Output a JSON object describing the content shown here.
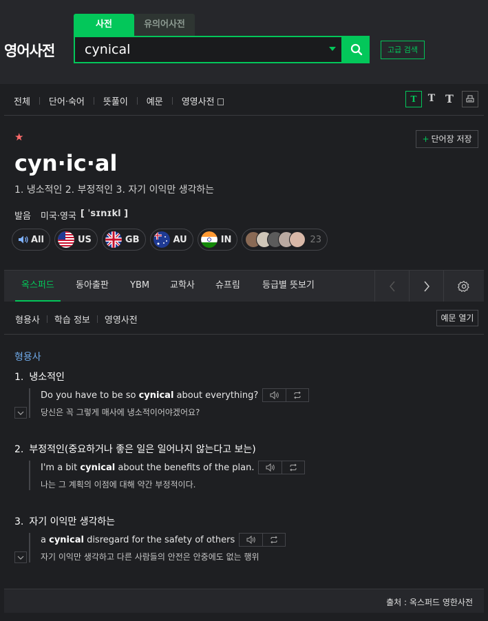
{
  "header": {
    "logo": "영어사전",
    "tabs": [
      "사전",
      "유의어사전"
    ],
    "search_value": "cynical",
    "advanced_label": "고급 검색"
  },
  "nav": {
    "items": [
      "전체",
      "단어·숙어",
      "뜻풀이",
      "예문",
      "영영사전"
    ],
    "font_sizes": [
      "T",
      "T",
      "T"
    ]
  },
  "entry": {
    "star": "★",
    "save_label": "단어장 저장",
    "word": "cyn·ic·al",
    "summary": "1. 냉소적인 2. 부정적인 3. 자기 이익만 생각하는",
    "pron_label": "발음",
    "pron_region": "미국·영국",
    "pron_ipa": "[ ˈsɪnɪkl ]",
    "audio": [
      "All",
      "US",
      "GB",
      "AU",
      "IN"
    ],
    "user_count": "23"
  },
  "sources": {
    "tabs": [
      "옥스퍼드",
      "동아출판",
      "YBM",
      "교학사",
      "슈프림",
      "등급별 뜻보기"
    ]
  },
  "sub_nav": {
    "items": [
      "형용사",
      "학습 정보",
      "영영사전"
    ],
    "example_toggle": "예문 열기"
  },
  "part_of_speech": "형용사",
  "senses": [
    {
      "num": "1.",
      "meaning": "냉소적인",
      "ex_pre": "Do you have to be so ",
      "ex_bold": "cynical",
      "ex_post": " about everything?",
      "ko": "당신은 꼭 그렇게 매사에 냉소적이어야겠어요?"
    },
    {
      "num": "2.",
      "meaning": "부정적인(중요하거나 좋은 일은 일어나지 않는다고 보는)",
      "ex_pre": "I'm a bit ",
      "ex_bold": "cynical",
      "ex_post": " about the benefits of the plan.",
      "ko": "나는 그 계획의 이점에 대해 약간 부정적이다."
    },
    {
      "num": "3.",
      "meaning": "자기 이익만 생각하는",
      "ex_pre": "a ",
      "ex_bold": "cynical",
      "ex_post": " disregard for the safety of others",
      "ko": "자기 이익만 생각하고 다른 사람들의 안전은 안중에도 없는 행위"
    }
  ],
  "footer": "출처 : 옥스퍼드 영한사전",
  "colors": {
    "accent": "#03c75a",
    "pos": "#6fa9e8",
    "star": "#ff6b6b"
  }
}
